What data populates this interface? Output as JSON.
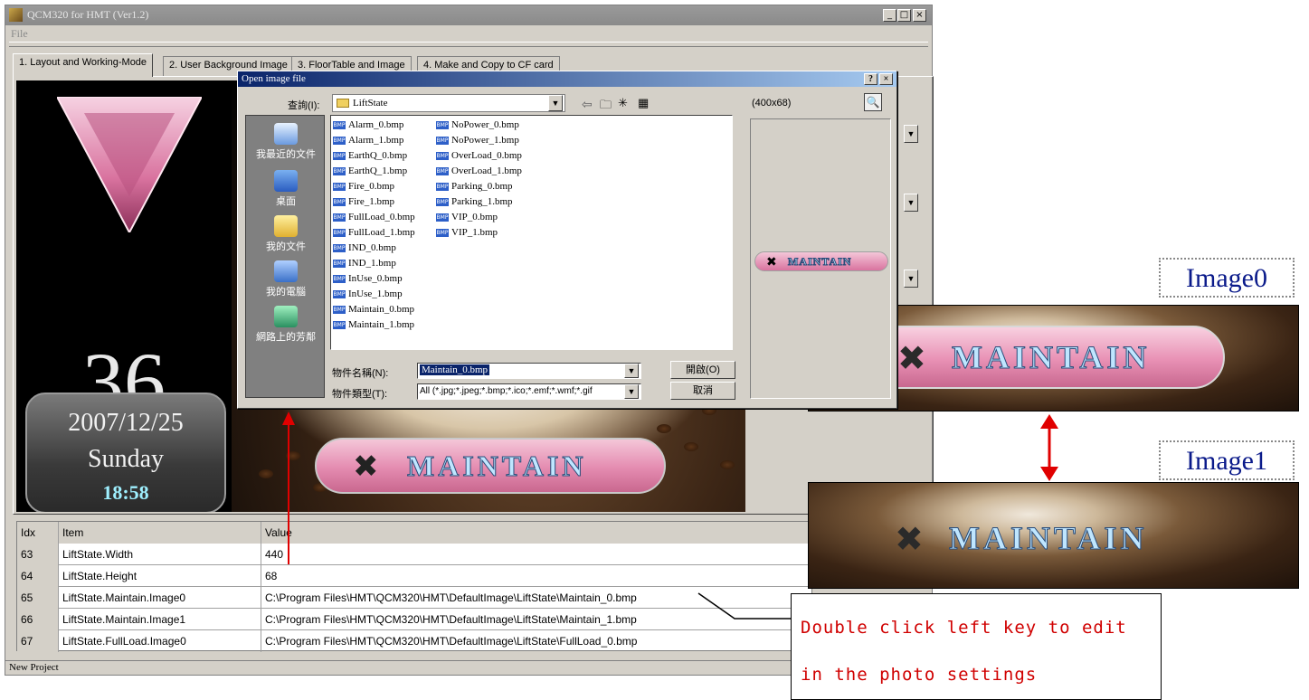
{
  "window": {
    "title": "QCM320 for HMT (Ver1.2)",
    "menu": [
      "File"
    ],
    "controls": [
      "_",
      "□",
      "×"
    ]
  },
  "tabs": [
    {
      "label": "1. Layout and Working-Mode",
      "active": true
    },
    {
      "label": "2. User Background Image",
      "active": false
    },
    {
      "label": "3. FloorTable and Image",
      "active": false
    },
    {
      "label": "4. Make and Copy to CF card",
      "active": false
    }
  ],
  "preview": {
    "floor": "36",
    "date": "2007/12/25",
    "weekday": "Sunday",
    "time": "18:58",
    "liftstate_text": "MAINTAIN"
  },
  "grid": {
    "headers": [
      "Idx",
      "Item",
      "Value"
    ],
    "rows": [
      {
        "idx": "63",
        "item": "LiftState.Width",
        "value": "440"
      },
      {
        "idx": "64",
        "item": "LiftState.Height",
        "value": "68"
      },
      {
        "idx": "65",
        "item": "LiftState.Maintain.Image0",
        "value": "C:\\Program Files\\HMT\\QCM320\\HMT\\DefaultImage\\LiftState\\Maintain_0.bmp"
      },
      {
        "idx": "66",
        "item": "LiftState.Maintain.Image1",
        "value": "C:\\Program Files\\HMT\\QCM320\\HMT\\DefaultImage\\LiftState\\Maintain_1.bmp"
      },
      {
        "idx": "67",
        "item": "LiftState.FullLoad.Image0",
        "value": "C:\\Program Files\\HMT\\QCM320\\HMT\\DefaultImage\\LiftState\\FullLoad_0.bmp"
      }
    ]
  },
  "statusbar": "New Project",
  "dialog": {
    "title": "Open image file",
    "help": "?",
    "close": "×",
    "lookin_label": "查詢(I):",
    "lookin_value": "LiftState",
    "preview_size": "(400x68)",
    "places": [
      "我最近的文件",
      "桌面",
      "我的文件",
      "我的電腦",
      "網路上的芳鄰"
    ],
    "files_col1": [
      "Alarm_0.bmp",
      "Alarm_1.bmp",
      "EarthQ_0.bmp",
      "EarthQ_1.bmp",
      "Fire_0.bmp",
      "Fire_1.bmp",
      "FullLoad_0.bmp",
      "FullLoad_1.bmp",
      "IND_0.bmp",
      "IND_1.bmp",
      "InUse_0.bmp",
      "InUse_1.bmp",
      "Maintain_0.bmp",
      "Maintain_1.bmp"
    ],
    "files_col2": [
      "NoPower_0.bmp",
      "NoPower_1.bmp",
      "OverLoad_0.bmp",
      "OverLoad_1.bmp",
      "Parking_0.bmp",
      "Parking_1.bmp",
      "VIP_0.bmp",
      "VIP_1.bmp"
    ],
    "filename_label": "物件名稱(N):",
    "filename_value": "Maintain_0.bmp",
    "filetype_label": "物件類型(T):",
    "filetype_value": "All (*.jpg;*.jpeg;*.bmp;*.ico;*.emf;*.wmf;*.gif",
    "open_button": "開啟(O)",
    "cancel_button": "取消",
    "bmp_tag": "BMP"
  },
  "annotations": {
    "image0_label": "Image0",
    "image1_label": "Image1",
    "badge_text": "MAINTAIN",
    "note_line1": "Double click left key to edit",
    "note_line2": "in the photo settings",
    "arrow_color": "#e00000"
  }
}
